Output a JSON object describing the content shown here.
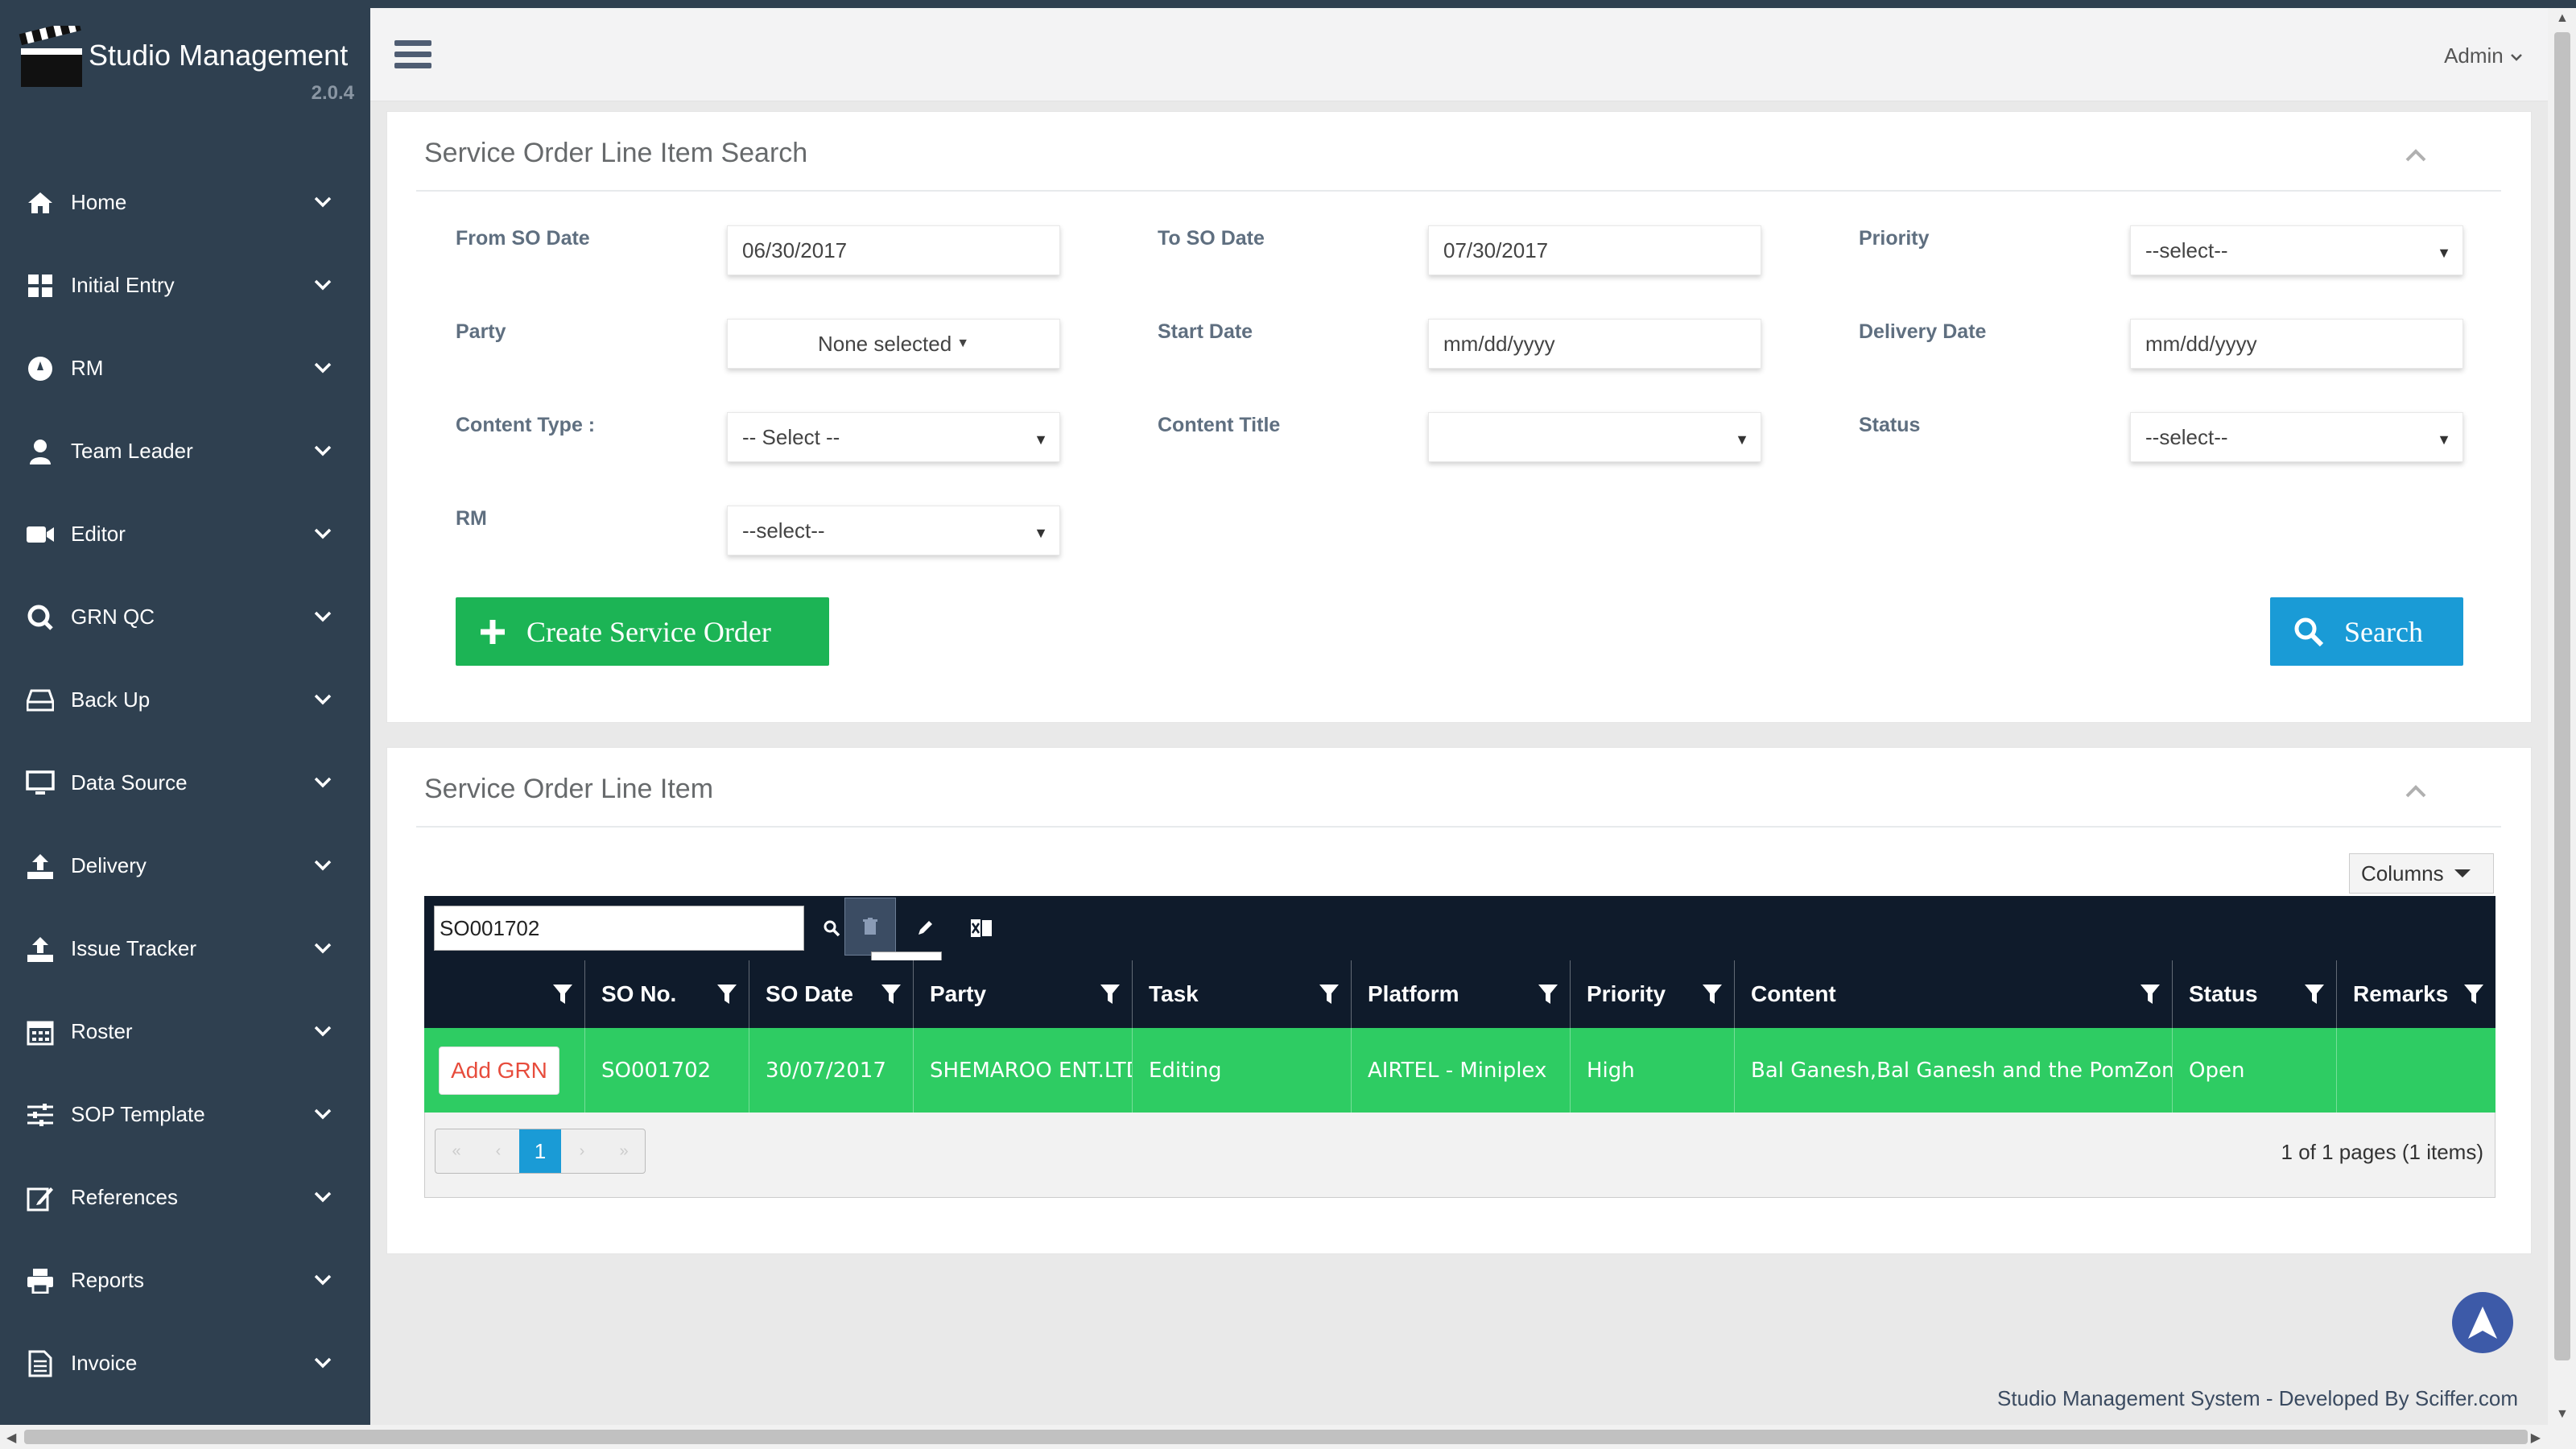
{
  "app": {
    "title": "Studio Management",
    "version": "2.0.4"
  },
  "sidebar": {
    "items": [
      {
        "label": "Home",
        "icon": "home-icon"
      },
      {
        "label": "Initial Entry",
        "icon": "grid-icon"
      },
      {
        "label": "RM",
        "icon": "compass-icon"
      },
      {
        "label": "Team Leader",
        "icon": "user-icon"
      },
      {
        "label": "Editor",
        "icon": "video-camera-icon"
      },
      {
        "label": "GRN QC",
        "icon": "q-icon"
      },
      {
        "label": "Back Up",
        "icon": "hard-drive-icon"
      },
      {
        "label": "Data Source",
        "icon": "monitor-icon"
      },
      {
        "label": "Delivery",
        "icon": "upload-icon"
      },
      {
        "label": "Issue Tracker",
        "icon": "upload-icon"
      },
      {
        "label": "Roster",
        "icon": "calendar-icon"
      },
      {
        "label": "SOP Template",
        "icon": "sliders-icon"
      },
      {
        "label": "References",
        "icon": "edit-icon"
      },
      {
        "label": "Reports",
        "icon": "printer-icon"
      },
      {
        "label": "Invoice",
        "icon": "file-icon"
      }
    ]
  },
  "header": {
    "user": "Admin"
  },
  "search_panel": {
    "title": "Service Order Line Item Search",
    "fields": {
      "from_so_date": {
        "label": "From SO Date",
        "value": "06/30/2017"
      },
      "to_so_date": {
        "label": "To SO Date",
        "value": "07/30/2017"
      },
      "priority": {
        "label": "Priority",
        "value": "--select--"
      },
      "party": {
        "label": "Party",
        "value": "None selected"
      },
      "start_date": {
        "label": "Start Date",
        "value": "mm/dd/yyyy"
      },
      "delivery_date": {
        "label": "Delivery Date",
        "value": "mm/dd/yyyy"
      },
      "content_type": {
        "label": "Content Type :",
        "value": "-- Select --"
      },
      "content_title": {
        "label": "Content Title",
        "value": ""
      },
      "status": {
        "label": "Status",
        "value": "--select--"
      },
      "rm": {
        "label": "RM",
        "value": "--select--"
      }
    },
    "create_button": "Create Service Order",
    "search_button": "Search"
  },
  "grid_panel": {
    "title": "Service Order Line Item",
    "columns_button": "Columns",
    "search_value": "SO001702",
    "tooltip": "Delete",
    "headers": [
      "",
      "SO No.",
      "SO Date",
      "Party",
      "Task",
      "Platform",
      "Priority",
      "Content",
      "Status",
      "Remarks"
    ],
    "rows": [
      {
        "action": "Add GRN",
        "so_no": "SO001702",
        "so_date": "30/07/2017",
        "party": "SHEMAROO ENT.LTD",
        "task": "Editing",
        "platform": "AIRTEL - Miniplex",
        "priority": "High",
        "content": "Bal Ganesh,Bal Ganesh and the PomZom Planet",
        "status": "Open",
        "remarks": ""
      }
    ],
    "pager": {
      "current_page": "1",
      "info": "1 of 1 pages (1 items)"
    }
  },
  "footer": "Studio Management System - Developed By Sciffer.com",
  "colors": {
    "sidebar": "#2f4050",
    "green": "#2ecc63",
    "blue": "#1a9bd6",
    "dark": "#0f1b2b"
  }
}
